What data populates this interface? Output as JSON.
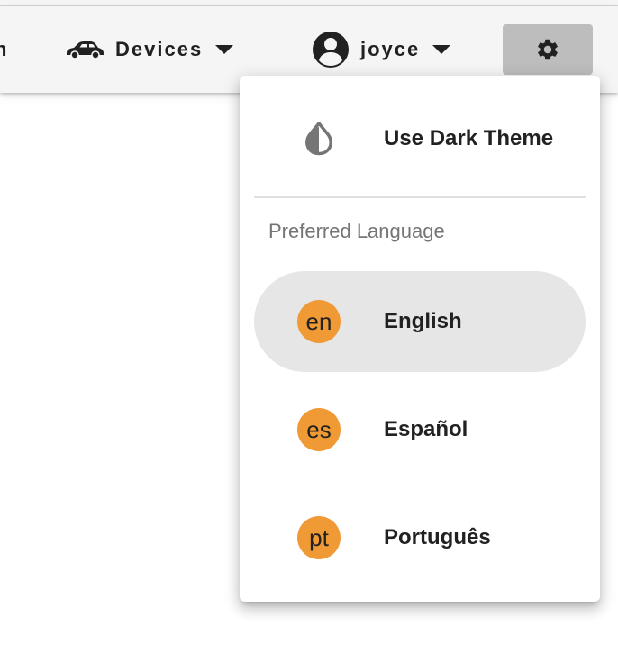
{
  "toolbar": {
    "cut_label": "n",
    "devices": {
      "label": "Devices",
      "icon": "car-icon"
    },
    "user": {
      "label": "joyce",
      "icon": "account-circle-icon"
    },
    "settings": {
      "icon": "gear-icon",
      "background": "#bdbdbd"
    }
  },
  "menu": {
    "dark_theme": {
      "label": "Use Dark Theme",
      "icon": "invert-colors-icon"
    },
    "language_header": "Preferred Language",
    "languages": [
      {
        "code": "en",
        "label": "English",
        "selected": true
      },
      {
        "code": "es",
        "label": "Español",
        "selected": false
      },
      {
        "code": "pt",
        "label": "Português",
        "selected": false
      }
    ],
    "colors": {
      "badge": "#f09a36",
      "selected_background": "#e6e6e6"
    }
  }
}
